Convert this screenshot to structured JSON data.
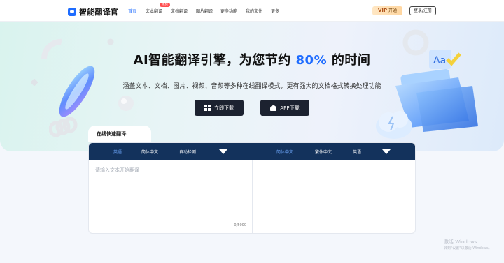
{
  "nav": {
    "logo_text": "智能翻译官",
    "items": [
      "首页",
      "文本翻译",
      "文档翻译",
      "图片翻译",
      "更多功能",
      "我的文件",
      "更多"
    ],
    "badge": "免费",
    "vip_prefix": "VIP",
    "vip_label": "开通",
    "login_label": "登录/注册"
  },
  "hero": {
    "title_part1": "AI智能翻译引擎，为您节约",
    "title_highlight": "80%",
    "title_part2": "的时间",
    "subtitle": "涵盖文本、文档、图片、视频、音频等多种在线翻译模式，更有强大的文档格式转换处理功能",
    "download_windows": "立即下载",
    "download_app": "APP下载",
    "accent_color": "#1e6cff"
  },
  "translate": {
    "tab_title": "在线快速翻译:",
    "source_langs": [
      "英语",
      "简体中文",
      "自动检测"
    ],
    "target_langs": [
      "简体中文",
      "繁体中文",
      "英语"
    ],
    "placeholder": "请输入文本开始翻译",
    "counter": "0/5000"
  },
  "watermark": {
    "line1": "激活 Windows",
    "line2": "转到\"设置\"以激活 Windows。"
  },
  "icons": [
    "windows-icon",
    "android-icon",
    "logo-icon",
    "chevron-down-icon"
  ]
}
